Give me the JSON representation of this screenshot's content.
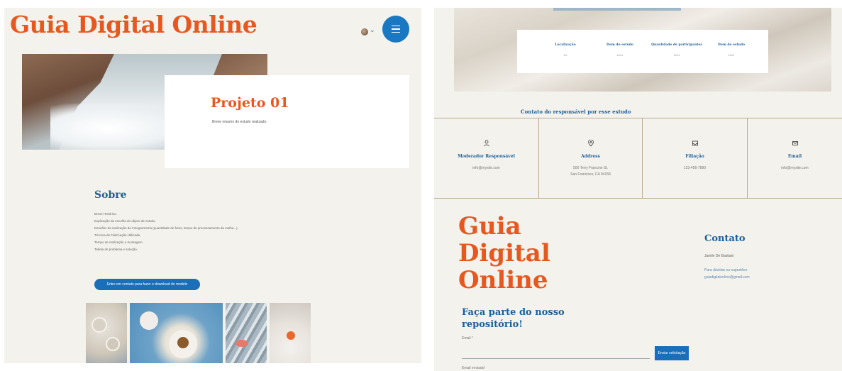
{
  "left_page": {
    "brand": "Guia Digital Online",
    "project": {
      "title": "Projeto 01",
      "summary": "Breve resumo do estudo realizado."
    },
    "sobre": {
      "title": "Sobre",
      "items": [
        "Breve Histórico.",
        "Explicação da escolha do objeto de estudo.",
        "Desafios da realização da Fotogrametria (quantidade de fotos, tempo de processamento da malha...)",
        "Técnica de Fabricação Utilizada.",
        "Tempo de realização e montagem.",
        "Tabela de problema x solução."
      ]
    },
    "cta_button": "Entre em contato para fazer o download do modelo"
  },
  "right_page": {
    "info_card": [
      {
        "label": "Localização",
        "value": "***"
      },
      {
        "label": "Item do estudo",
        "value": "*****"
      },
      {
        "label": "Quantidade de participantes",
        "value": "*****"
      },
      {
        "label": "Item do estudo",
        "value": "*****"
      }
    ],
    "contact_heading": "Contato do responsável por esse estudo",
    "contact_cells": [
      {
        "title": "Moderador Responsável",
        "value_1": "info@mysite.com",
        "value_2": ""
      },
      {
        "title": "Address",
        "value_1": "500 Terry Francine St.",
        "value_2": "San Francisco, CA 94158"
      },
      {
        "title": "Filiação",
        "value_1": "123-456-7890",
        "value_2": ""
      },
      {
        "title": "Email",
        "value_1": "info@mysite.com",
        "value_2": ""
      }
    ],
    "footer_brand": {
      "line1": "Guia",
      "line2": "Digital",
      "line3": "Online"
    },
    "contato": {
      "title": "Contato",
      "name": "Jamile De Bastiani",
      "text": "Para dúvidas ou sugestões",
      "email": "guiadigitalonline@gmail.com"
    },
    "join": {
      "title": "Faça parte do nosso repositório!",
      "email_label": "Email *",
      "email_value": "",
      "send_button": "Enviar solicitação",
      "sent_message": "Email enviado!"
    }
  },
  "icons": [
    "menu-icon",
    "chevron-down-icon",
    "user-icon",
    "location-pin-icon",
    "inbox-icon",
    "envelope-icon"
  ],
  "colors": {
    "brand_orange": "#e8571e",
    "accent_blue": "#1a78c2",
    "heading_blue": "#1f5f99",
    "background": "#f4f2ec"
  }
}
